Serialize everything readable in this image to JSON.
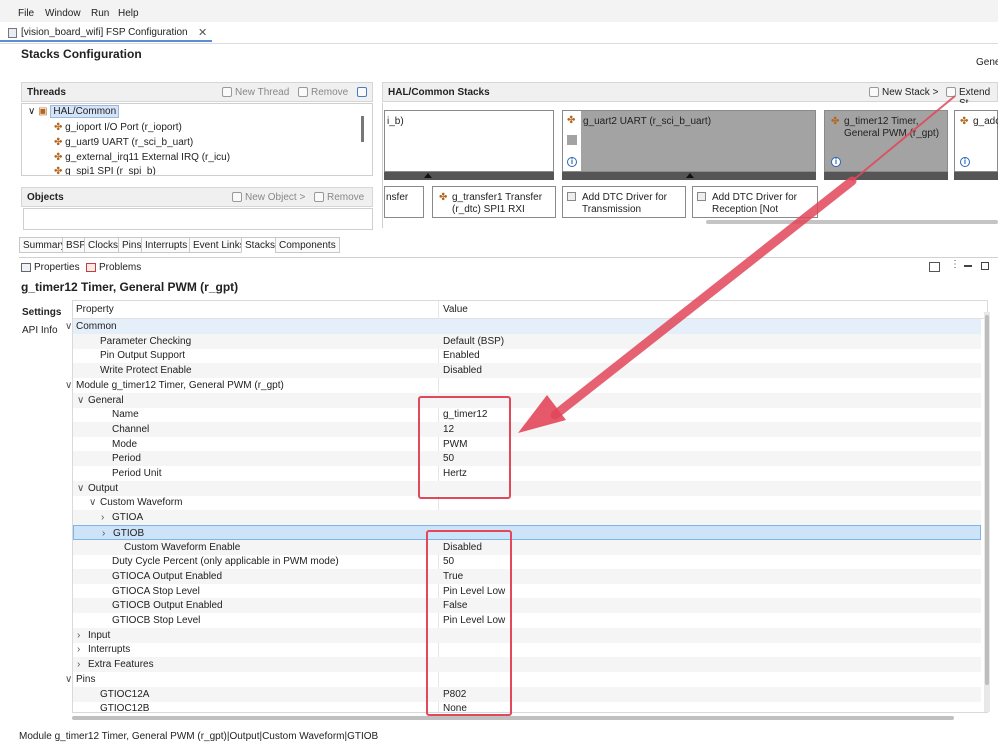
{
  "menu": [
    "File",
    "Window",
    "Run",
    "Help"
  ],
  "editor_tab": {
    "title": "[vision_board_wifi] FSP Configuration",
    "close": "✕"
  },
  "page": {
    "title": "Stacks Configuration",
    "right_label": "Gene"
  },
  "threads_panel": {
    "title": "Threads",
    "new_label": "New Thread",
    "remove_label": "Remove",
    "root": "HAL/Common",
    "items": [
      "g_ioport I/O Port (r_ioport)",
      "g_uart9 UART (r_sci_b_uart)",
      "g_external_irq11 External IRQ (r_icu)",
      "g_spi1 SPI (r_spi_b)"
    ]
  },
  "objects_panel": {
    "title": "Objects",
    "new_label": "New Object >",
    "remove_label": "Remove"
  },
  "stacks_panel": {
    "title": "HAL/Common Stacks",
    "new_stack": "New Stack >",
    "extend": "Extend St",
    "boxes": [
      {
        "text": "i_b)"
      },
      {
        "text": "g_uart2 UART (r_sci_b_uart)"
      },
      {
        "text": "g_timer12 Timer,\nGeneral PWM (r_gpt)"
      },
      {
        "text": "g_adc"
      }
    ],
    "sub_boxes": [
      {
        "text": "nsfer"
      },
      {
        "text": "g_transfer1 Transfer\n(r_dtc) SPI1 RXI"
      },
      {
        "text": "Add DTC Driver for\nTransmission"
      },
      {
        "text": "Add DTC Driver for\nReception [Not"
      }
    ]
  },
  "config_tabs": [
    "Summary",
    "BSP",
    "Clocks",
    "Pins",
    "Interrupts",
    "Event Links",
    "Stacks",
    "Components"
  ],
  "bottom_tabs": {
    "properties": "Properties",
    "problems": "Problems"
  },
  "module_title": "g_timer12 Timer, General PWM (r_gpt)",
  "side_tabs": [
    "Settings",
    "API Info"
  ],
  "grid": {
    "header": {
      "property": "Property",
      "value": "Value"
    },
    "rows": [
      {
        "indent": 0,
        "arrow": "∨",
        "property": "Common",
        "value": "",
        "style": "hi"
      },
      {
        "indent": 2,
        "arrow": "",
        "property": "Parameter Checking",
        "value": "Default (BSP)",
        "style": ""
      },
      {
        "indent": 2,
        "arrow": "",
        "property": "Pin Output Support",
        "value": "Enabled",
        "style": ""
      },
      {
        "indent": 2,
        "arrow": "",
        "property": "Write Protect Enable",
        "value": "Disabled",
        "style": ""
      },
      {
        "indent": 0,
        "arrow": "∨",
        "property": "Module g_timer12 Timer, General PWM (r_gpt)",
        "value": "",
        "style": ""
      },
      {
        "indent": 1,
        "arrow": "∨",
        "property": "General",
        "value": "",
        "style": ""
      },
      {
        "indent": 3,
        "arrow": "",
        "property": "Name",
        "value": "g_timer12",
        "style": ""
      },
      {
        "indent": 3,
        "arrow": "",
        "property": "Channel",
        "value": "12",
        "style": ""
      },
      {
        "indent": 3,
        "arrow": "",
        "property": "Mode",
        "value": "PWM",
        "style": ""
      },
      {
        "indent": 3,
        "arrow": "",
        "property": "Period",
        "value": "50",
        "style": ""
      },
      {
        "indent": 3,
        "arrow": "",
        "property": "Period Unit",
        "value": "Hertz",
        "style": ""
      },
      {
        "indent": 1,
        "arrow": "∨",
        "property": "Output",
        "value": "",
        "style": ""
      },
      {
        "indent": 2,
        "arrow": "∨",
        "property": "Custom Waveform",
        "value": "",
        "style": ""
      },
      {
        "indent": 3,
        "arrow": "›",
        "property": "GTIOA",
        "value": "",
        "style": ""
      },
      {
        "indent": 3,
        "arrow": "›",
        "property": "GTIOB",
        "value": "",
        "style": "sel"
      },
      {
        "indent": 4,
        "arrow": "",
        "property": "Custom Waveform Enable",
        "value": "Disabled",
        "style": ""
      },
      {
        "indent": 3,
        "arrow": "",
        "property": "Duty Cycle Percent (only applicable in PWM mode)",
        "value": "50",
        "style": ""
      },
      {
        "indent": 3,
        "arrow": "",
        "property": "GTIOCA Output Enabled",
        "value": "True",
        "style": ""
      },
      {
        "indent": 3,
        "arrow": "",
        "property": "GTIOCA Stop Level",
        "value": "Pin Level Low",
        "style": ""
      },
      {
        "indent": 3,
        "arrow": "",
        "property": "GTIOCB Output Enabled",
        "value": "False",
        "style": ""
      },
      {
        "indent": 3,
        "arrow": "",
        "property": "GTIOCB Stop Level",
        "value": "Pin Level Low",
        "style": ""
      },
      {
        "indent": 1,
        "arrow": "›",
        "property": "Input",
        "value": "",
        "style": ""
      },
      {
        "indent": 1,
        "arrow": "›",
        "property": "Interrupts",
        "value": "",
        "style": ""
      },
      {
        "indent": 1,
        "arrow": "›",
        "property": "Extra Features",
        "value": "",
        "style": ""
      },
      {
        "indent": 0,
        "arrow": "∨",
        "property": "Pins",
        "value": "",
        "style": ""
      },
      {
        "indent": 2,
        "arrow": "",
        "property": "GTIOC12A",
        "value": "P802",
        "style": ""
      },
      {
        "indent": 2,
        "arrow": "",
        "property": "GTIOC12B",
        "value": "None",
        "style": ""
      }
    ]
  },
  "status_bar": "Module g_timer12 Timer, General PWM (r_gpt)|Output|Custom Waveform|GTIOB",
  "colors": {
    "annotation": "#e2475a",
    "selection": "#cce3f8",
    "accent": "#5a8fd6"
  }
}
